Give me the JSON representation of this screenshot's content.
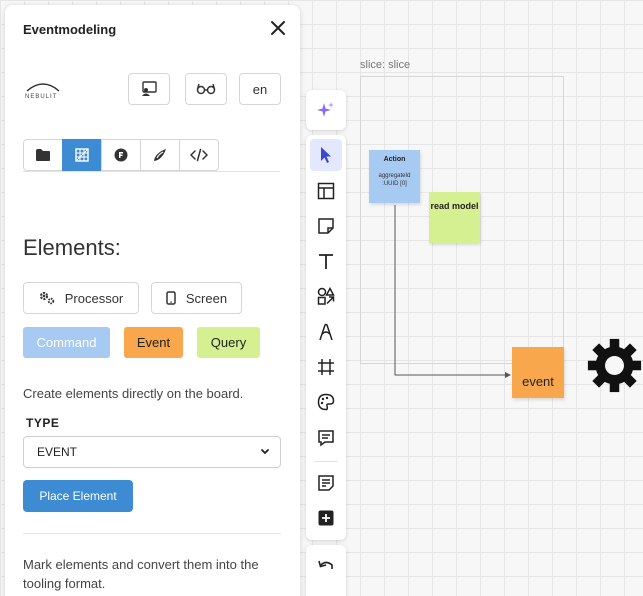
{
  "panel": {
    "title": "Eventmodeling",
    "logo_text": "NEBULIT",
    "language_button": "en"
  },
  "tabs": [
    {
      "icon": "folder-icon",
      "active": false
    },
    {
      "icon": "grid-icon",
      "active": true
    },
    {
      "icon": "circle-badge-icon",
      "active": false
    },
    {
      "icon": "rocket-icon",
      "active": false
    },
    {
      "icon": "code-icon",
      "active": false
    }
  ],
  "elements": {
    "heading": "Elements:",
    "processor_label": "Processor",
    "screen_label": "Screen",
    "command_label": "Command",
    "event_label": "Event",
    "query_label": "Query",
    "help_text": "Create elements directly on the board.",
    "type_label": "TYPE",
    "type_value": "EVENT",
    "place_button": "Place Element",
    "mark_text": "Mark elements and convert them into the tooling format."
  },
  "colors": {
    "accent": "#3d8bd3",
    "command": "#a7caf2",
    "event": "#f8a74d",
    "query": "#d4f090"
  },
  "board": {
    "slice_label": "slice: slice",
    "action_title": "Action",
    "action_body": "aggregateId :UUID [0]",
    "read_model_label": "read model",
    "event_label": "event"
  }
}
